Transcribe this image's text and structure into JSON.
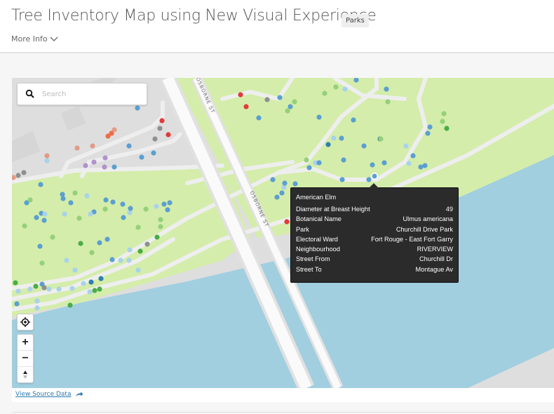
{
  "header": {
    "title": "Tree Inventory Map using New Visual Experience",
    "category_badge": "Parks",
    "more_info_label": "More Info",
    "more_info_icon": "chevron-down-icon"
  },
  "map": {
    "search": {
      "placeholder": "Search",
      "value": "",
      "icon": "search-icon"
    },
    "street_labels": [
      "OSBORNE ST",
      "OSBORNE ST"
    ],
    "controls": {
      "locate_icon": "crosshair-icon",
      "zoom_in_label": "+",
      "zoom_out_label": "−",
      "compass_icon": "compass-icon"
    },
    "colors": {
      "land": "#dedede",
      "park": "#d4edaa",
      "water": "#a1cfe0",
      "road": "#f2f2f2",
      "road_edge": "#e4e4e4"
    },
    "tree_category_colors": {
      "blue": "#5b9fd0",
      "light_blue": "#a9d2ea",
      "dark_blue": "#2f7fb0",
      "light_green": "#95d07a",
      "green": "#4aad45",
      "gray": "#8f8f8f",
      "red": "#e33a3a",
      "salmon": "#e39a86",
      "orange": "#ef6b43",
      "purple": "#b092cc"
    },
    "tooltip": {
      "title": "American Elm",
      "rows": [
        {
          "label": "Diameter at Breast Height",
          "value": "49"
        },
        {
          "label": "Botanical Name",
          "value": "Ulmus americana"
        },
        {
          "label": "Park",
          "value": "Churchill Drive Park"
        },
        {
          "label": "Electoral Ward",
          "value": "Fort Rouge - East Fort Garry"
        },
        {
          "label": "Neighbourhood",
          "value": "RIVERVIEW"
        },
        {
          "label": "Street From",
          "value": "Churchill Dr"
        },
        {
          "label": "Street To",
          "value": "Montague Av"
        }
      ]
    }
  },
  "footer": {
    "view_source_label": "View Source Data",
    "view_source_icon": "arrow-right-icon"
  }
}
